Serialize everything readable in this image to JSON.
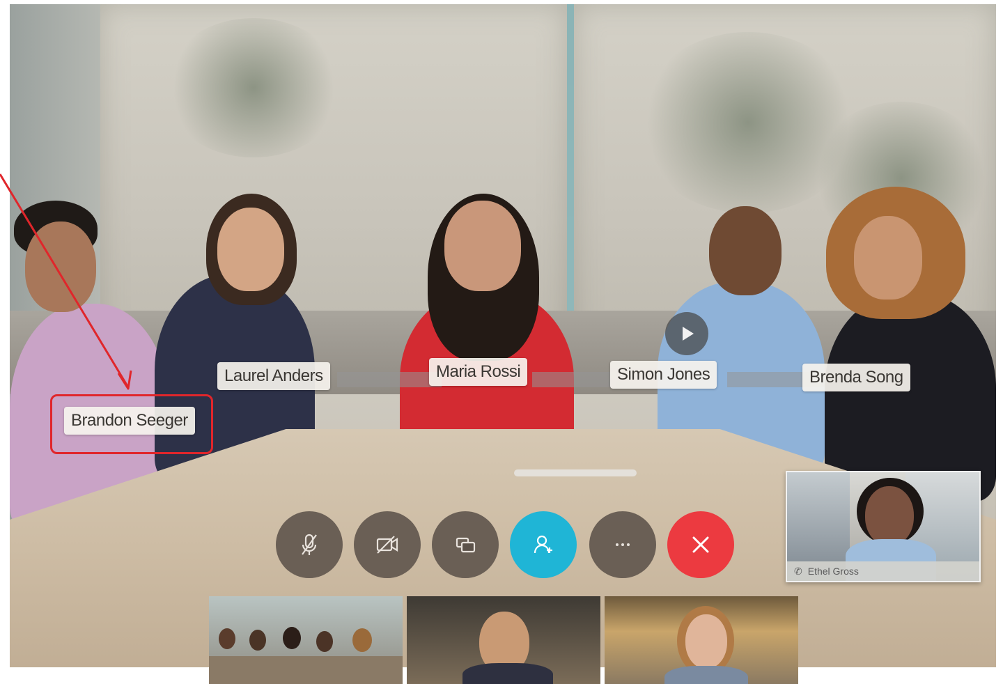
{
  "participants": [
    {
      "name": "Brandon Seeger"
    },
    {
      "name": "Laurel Anders"
    },
    {
      "name": "Maria Rossi"
    },
    {
      "name": "Simon Jones"
    },
    {
      "name": "Brenda Song"
    }
  ],
  "self_view": {
    "name": "Ethel Gross"
  },
  "controls": [
    {
      "icon": "mute-microphone-icon"
    },
    {
      "icon": "stop-video-icon"
    },
    {
      "icon": "share-screen-icon"
    },
    {
      "icon": "add-participant-icon",
      "color": "#1fb5d6"
    },
    {
      "icon": "more-options-icon"
    },
    {
      "icon": "end-call-icon",
      "color": "#ec3a40"
    }
  ],
  "annotation": {
    "color": "#e0262b"
  }
}
